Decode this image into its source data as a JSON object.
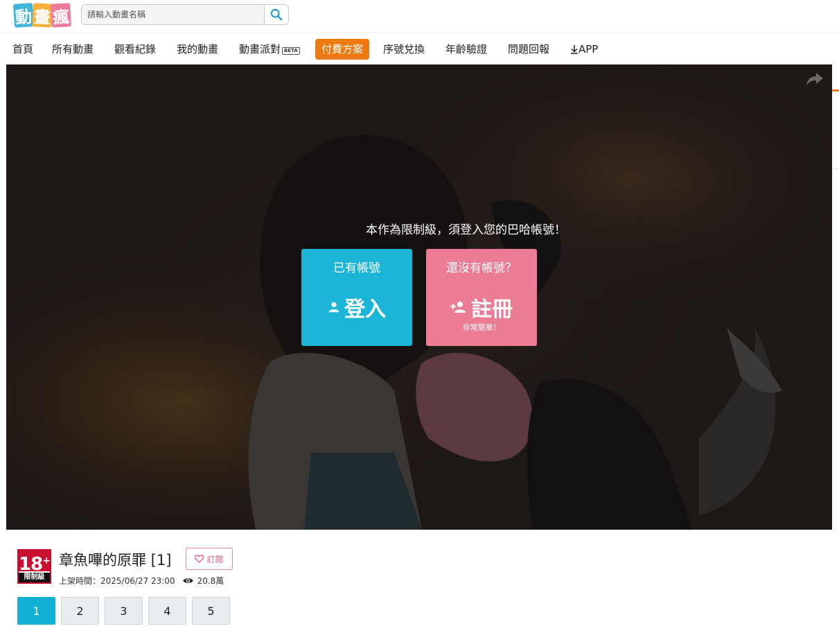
{
  "logo": {
    "chars": [
      "動",
      "畫",
      "瘋"
    ]
  },
  "search": {
    "placeholder": "請輸入動畫名稱"
  },
  "nav": {
    "items": [
      "首頁",
      "所有動畫",
      "觀看紀錄",
      "我的動畫",
      "動畫派對",
      "付費方案",
      "序號兌換",
      "年齡驗證",
      "問題回報",
      "APP"
    ],
    "beta_badge": "BETA",
    "active_color": "#ee7a0f"
  },
  "gate": {
    "message": "本作為限制級，須登入您的巴哈帳號！",
    "login": {
      "top": "已有帳號",
      "label": "登入",
      "color": "#1cb5d8"
    },
    "register": {
      "top": "還沒有帳號？",
      "label": "註冊",
      "note": "非常簡單！",
      "color": "#ec7b94"
    }
  },
  "anime": {
    "rating_num": "18",
    "rating_plus": "+",
    "rating_label": "限制級",
    "title": "章魚嗶的原罪 [1]",
    "subscribe": "訂閱",
    "upload_label": "上架時間：2025/06/27 23:00",
    "views": "20.8萬"
  },
  "episodes": [
    "1",
    "2",
    "3",
    "4",
    "5"
  ],
  "current_episode": "1",
  "icons": [
    "search-icon",
    "share-icon",
    "user-icon",
    "user-add-icon",
    "heart-icon",
    "eye-icon",
    "download-icon"
  ]
}
